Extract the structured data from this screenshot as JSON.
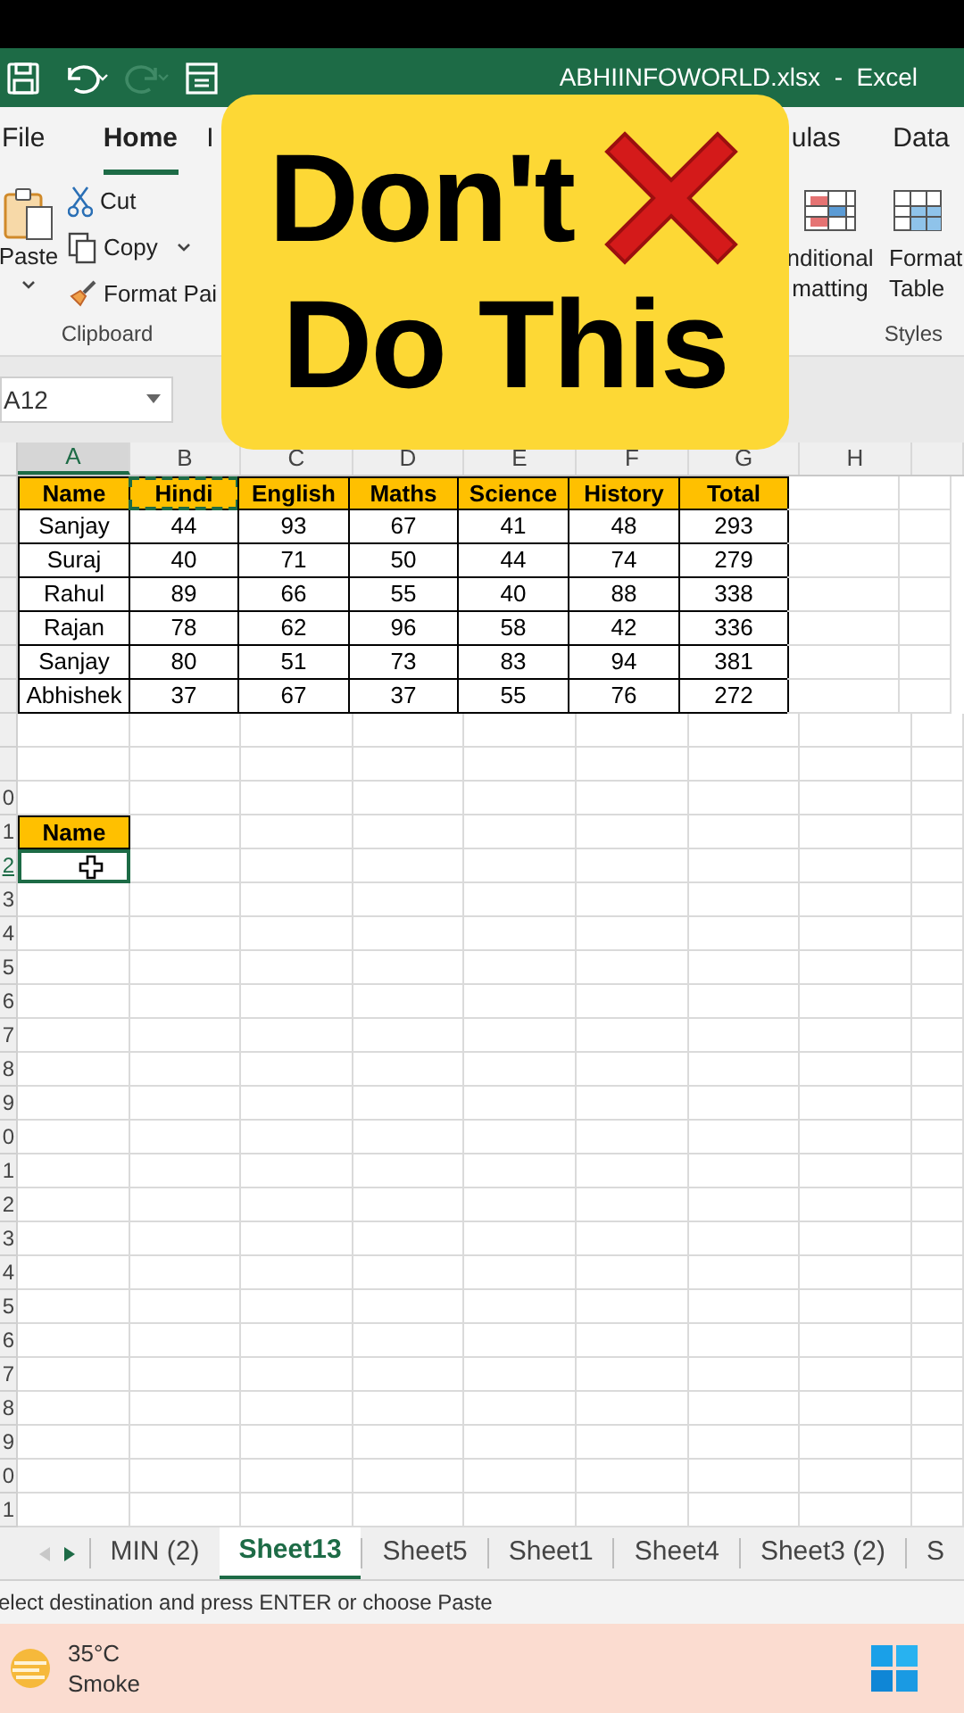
{
  "title_bar": {
    "title": "ABHIINFOWORLD.xlsx  -  Excel"
  },
  "ribbon_tabs": [
    {
      "label": "File",
      "selected": false
    },
    {
      "label": "Home",
      "selected": true
    },
    {
      "label": "I",
      "selected": false
    },
    {
      "label": "ulas",
      "selected": false
    },
    {
      "label": "Data",
      "selected": false
    }
  ],
  "clipboard": {
    "paste": "Paste",
    "cut": "Cut",
    "copy": "Copy",
    "format_painter": "Format Pai",
    "group_label": "Clipboard"
  },
  "styles": {
    "conditional_formatting": [
      "nditional",
      "matting"
    ],
    "format_as_table": [
      "Format",
      "Table"
    ],
    "group_label": "Styles"
  },
  "name_box": "A12",
  "columns": [
    {
      "label": "A",
      "selected": true
    },
    {
      "label": "B",
      "selected": false
    },
    {
      "label": "C",
      "selected": false
    },
    {
      "label": "D",
      "selected": false
    },
    {
      "label": "E",
      "selected": false
    },
    {
      "label": "F",
      "selected": false
    },
    {
      "label": "G",
      "selected": false
    },
    {
      "label": "H",
      "selected": false
    }
  ],
  "row_labels": [
    {
      "label": "0",
      "selected": false
    },
    {
      "label": "1",
      "selected": false
    },
    {
      "label": "2",
      "selected": true
    },
    {
      "label": "3",
      "selected": false
    },
    {
      "label": "4",
      "selected": false
    },
    {
      "label": "5",
      "selected": false
    },
    {
      "label": "6",
      "selected": false
    },
    {
      "label": "7",
      "selected": false
    },
    {
      "label": "8",
      "selected": false
    },
    {
      "label": "9",
      "selected": false
    },
    {
      "label": "0",
      "selected": false
    },
    {
      "label": "1",
      "selected": false
    },
    {
      "label": "2",
      "selected": false
    },
    {
      "label": "3",
      "selected": false
    },
    {
      "label": "4",
      "selected": false
    },
    {
      "label": "5",
      "selected": false
    },
    {
      "label": "6",
      "selected": false
    },
    {
      "label": "7",
      "selected": false
    },
    {
      "label": "8",
      "selected": false
    },
    {
      "label": "9",
      "selected": false
    },
    {
      "label": "0",
      "selected": false
    },
    {
      "label": "1",
      "selected": false
    }
  ],
  "table": {
    "header": [
      {
        "text": "Name",
        "copied": false
      },
      {
        "text": "Hindi",
        "copied": true
      },
      {
        "text": "English",
        "copied": false
      },
      {
        "text": "Maths",
        "copied": false
      },
      {
        "text": "Science",
        "copied": false
      },
      {
        "text": "History",
        "copied": false
      },
      {
        "text": "Total",
        "copied": false
      }
    ],
    "rows": [
      [
        "Sanjay",
        "44",
        "93",
        "67",
        "41",
        "48",
        "293"
      ],
      [
        "Suraj",
        "40",
        "71",
        "50",
        "44",
        "74",
        "279"
      ],
      [
        "Rahul",
        "89",
        "66",
        "55",
        "40",
        "88",
        "338"
      ],
      [
        "Rajan",
        "78",
        "62",
        "96",
        "58",
        "42",
        "336"
      ],
      [
        "Sanjay",
        "80",
        "51",
        "73",
        "83",
        "94",
        "381"
      ],
      [
        "Abhishek",
        "37",
        "67",
        "37",
        "55",
        "76",
        "272"
      ]
    ]
  },
  "lookup": {
    "header": "Name",
    "answer_selected": true
  },
  "sheet_tabs": [
    {
      "label": "MIN (2)",
      "selected": false
    },
    {
      "label": "Sheet13",
      "selected": true
    },
    {
      "label": "Sheet5",
      "selected": false
    },
    {
      "label": "Sheet1",
      "selected": false
    },
    {
      "label": "Sheet4",
      "selected": false
    },
    {
      "label": "Sheet3 (2)",
      "selected": false
    },
    {
      "label": "S",
      "selected": false
    }
  ],
  "status_bar": "elect destination and press ENTER or choose Paste",
  "taskbar": {
    "temperature": "35°C",
    "weather": "Smoke"
  },
  "overlay": {
    "line_1": "Don't",
    "line_2": "Do This"
  }
}
